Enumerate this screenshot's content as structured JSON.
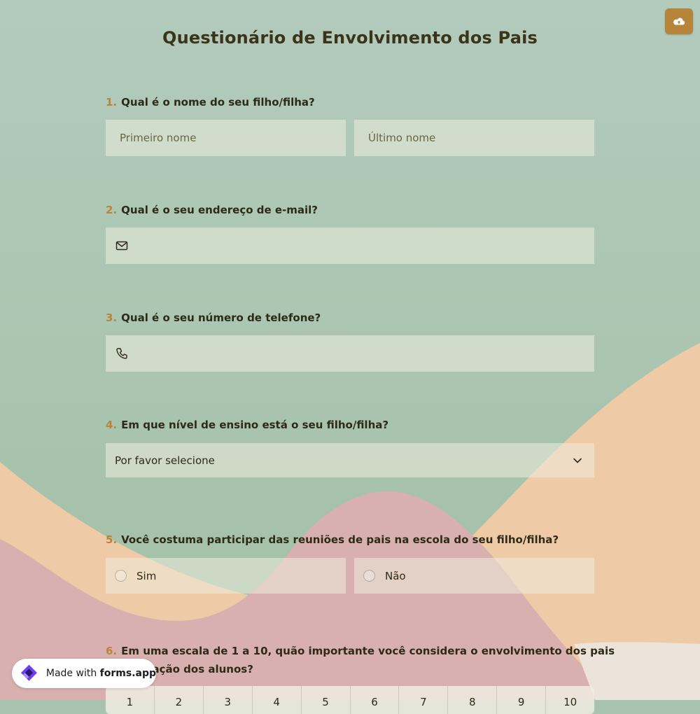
{
  "form": {
    "title": "Questionário de Envolvimento dos Pais",
    "upload_icon": "cloud-upload-icon"
  },
  "questions": [
    {
      "number": "1.",
      "label": "Qual é o nome do seu filho/filha?",
      "first_name_placeholder": "Primeiro nome",
      "last_name_placeholder": "Último nome"
    },
    {
      "number": "2.",
      "label": "Qual é o seu endereço de e-mail?",
      "icon": "envelope-icon",
      "value": ""
    },
    {
      "number": "3.",
      "label": "Qual é o seu número de telefone?",
      "icon": "phone-icon",
      "value": ""
    },
    {
      "number": "4.",
      "label": "Em que nível de ensino está o seu filho/filha?",
      "selected": "Por favor selecione",
      "icon": "chevron-down-icon"
    },
    {
      "number": "5.",
      "label": "Você costuma participar das reuniões de pais na escola do seu filho/filha?",
      "options": [
        "Sim",
        "Não"
      ]
    },
    {
      "number": "6.",
      "label_line1": "Em uma escala de 1 a 10, quão importante você considera o envolvimento dos pais",
      "label_line2": "na educação dos alunos?",
      "scale": [
        "1",
        "2",
        "3",
        "4",
        "5",
        "6",
        "7",
        "8",
        "9",
        "10"
      ]
    }
  ],
  "badge": {
    "prefix": "Made with ",
    "brand": "forms.app",
    "icon": "forms-app-logo-icon"
  },
  "colors": {
    "accent": "#b7853a",
    "background_green": "#a8c4b0",
    "peach": "#efcaa6",
    "pink": "#d8b0b0"
  }
}
